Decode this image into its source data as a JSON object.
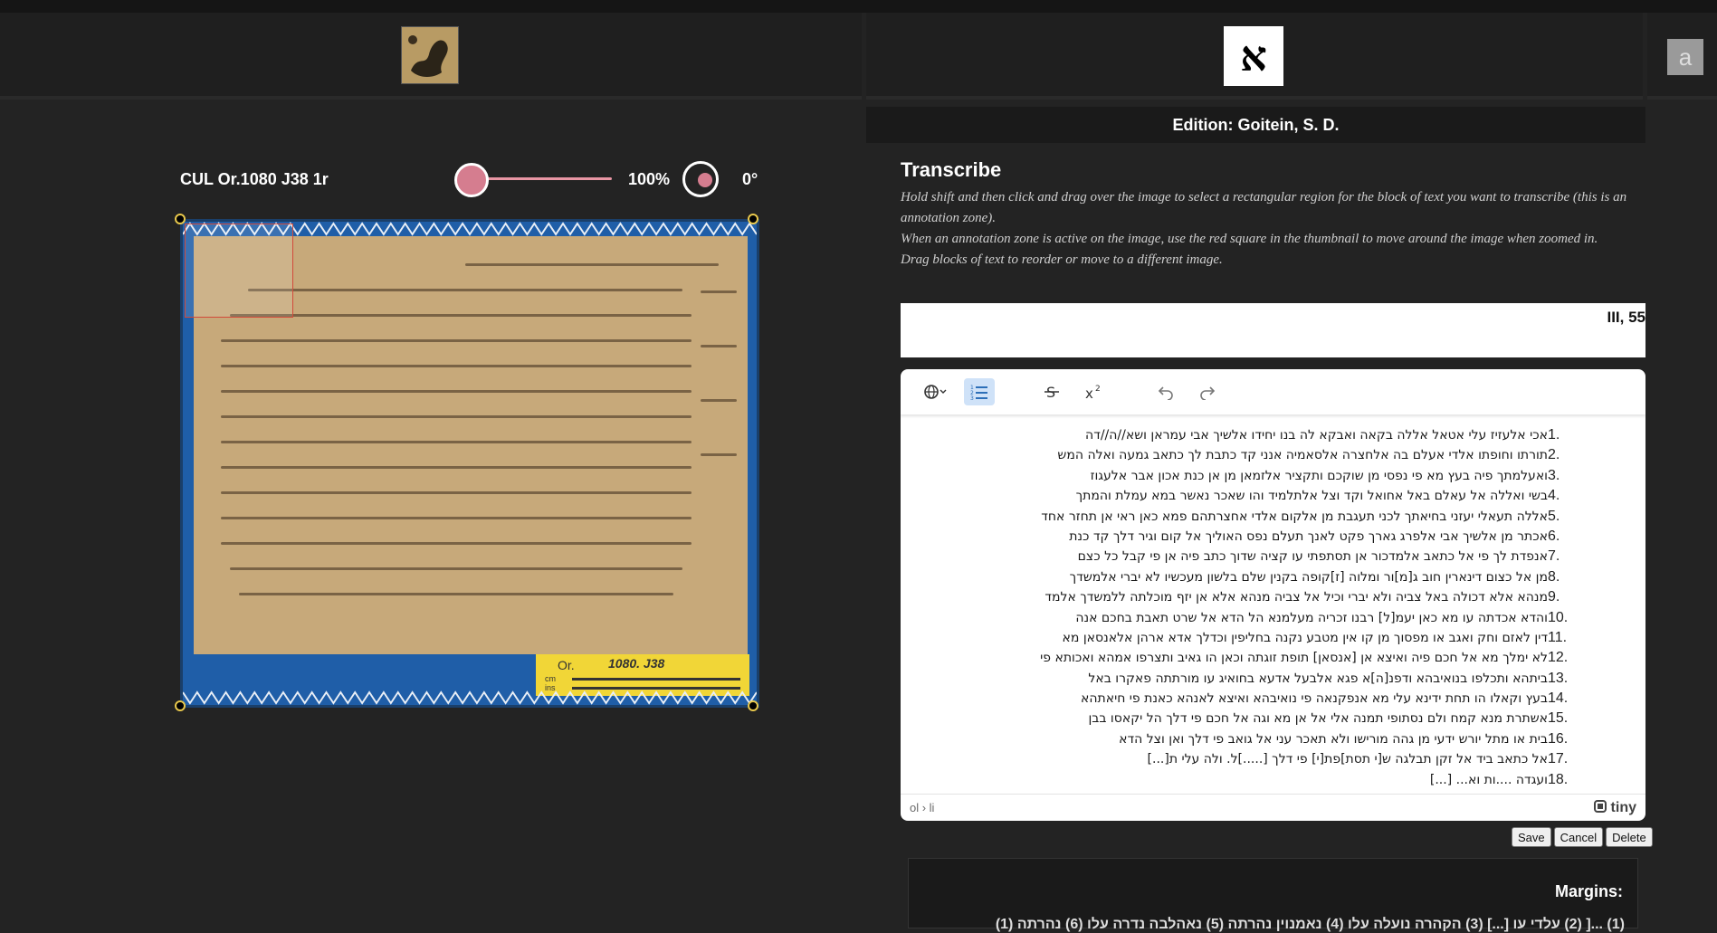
{
  "top_thumbs": {
    "alef_label": "א",
    "a_label": "a"
  },
  "edition": {
    "label": "Edition: Goitein, S. D."
  },
  "viewer": {
    "shelfmark": "CUL Or.1080 J38 1r",
    "zoom_percent": 100,
    "zoom_label": "100%",
    "rotation_label": "0°",
    "image_label": {
      "prefix": "Or.",
      "number": "1080. J38",
      "cm": "cm",
      "ins": "ins"
    }
  },
  "transcribe": {
    "title": "Transcribe",
    "help": [
      "Hold shift and then click and drag over the image to select a rectangular region for the block of text you want to transcribe (this is an annotation zone).",
      "When an annotation zone is active on the image, use the red square in the thumbnail to move around the image when zoomed in.",
      "Drag blocks of text to reorder or move to a different image."
    ],
    "locus": "III, 55"
  },
  "editor": {
    "toolbar": [
      "globe-language-icon",
      "numbered-list-icon",
      "strikethrough-icon",
      "superscript-icon",
      "undo-icon",
      "redo-icon"
    ],
    "lines": [
      {
        "n": "1.",
        "text": "אכי אלעזיז עלי אטאל אללה בקאה ואבקא לה בנו יחידו אלשיך אבי עמראן ושא//ה//דה"
      },
      {
        "n": "2.",
        "text": "תורתו וחופתו אלדי אעלם בה אלחצרה אלסאמיה אנני קד כתבת לך כתאב גמעה ואלה המש"
      },
      {
        "n": "3.",
        "text": "ואעלמתך פיה בעץ מא פי נפסי מן שוקכם ותקציר אלזמאן מן אן כנת אכון אבר אלעגוז"
      },
      {
        "n": "4.",
        "text": "בשי ואללה אל עאלם באל אחואל וקד וצל אלתלמיד והו שאכר נאשר במא עמלת והמתך"
      },
      {
        "n": "5.",
        "text": "אללה תעאלי יעזני בחיאתך לכני תעגבת מן אלקום אלדי אחצרתהם פמא כאן ראי אן תחזר אחד"
      },
      {
        "n": "6.",
        "text": "אכתר מן אלשיך אבי אלפרג גארך פקט לאנך תעלם נפס האוליך אל קום וגיר דלך קד כנת"
      },
      {
        "n": "7.",
        "text": "אנפדת לך פי אל כתאב אלמדכור אן תסתפתי עו קציה שדוך כתב פיה אן פי קבל כל כצם"
      },
      {
        "n": "8.",
        "text": "מן אל כצום דינארין חוב ג[מ]ור ומלוה [ז]קופה בקנין שלם בלשון מעכשיו לא יברי אלמשדך"
      },
      {
        "n": "9.",
        "text": "מנהא אלא דכולה באל צביה ולא יברי וכיל אל צביה מנהא אלא אן יזף מוכלתה ללמשדך אלמד"
      },
      {
        "n": "10.",
        "text": "והדא אכדתה עו מא כאן יעמ[ל] רבנו זכריה מעלמנא הל הדא אל שרט תאבת בחכם אנה"
      },
      {
        "n": "11.",
        "text": "דין לאזם וחק ואגב או מפסוך מן קו אין מטבע נקנה בחליפין וכדלך אדא ארהן אלאנסאן מא"
      },
      {
        "n": "12.",
        "text": "לא ימלך מא אל חכם פיה ואיצא אן [אנסאן] תופת זוגתה וכאן הו גאיב ותצרפו אמהא ואכותא פי"
      },
      {
        "n": "13.",
        "text": "ביתהא ותכלפו בנואיבהא ודפנ[ה]א פגא אלבעל אדעא בחואיג עו מורתתה פאקרו באל"
      },
      {
        "n": "14.",
        "text": "בעץ וקאלו הו תחת ידינא עלי מא אנפקנאה פי נואיבהא ואיצא לאנהא כאנת פי חיאתהא"
      },
      {
        "n": "15.",
        "text": "אשתרת מנא קמח ולם נסתופי תמנה אלי אל אן מא וגה אל חכם פי דלך הל יקאסו בבן"
      },
      {
        "n": "16.",
        "text": "בית או מתל יורש ידעי מן גהה מורישו ולא תאכר עני אל גואב פי דלך ואן וצל הדא"
      },
      {
        "n": "17.",
        "text": "אל כתאב ביד אל זקן תבלגה ש[י תסת]פת[י] פי דלך [.....]ל. ולה עלי ת[...]"
      },
      {
        "n": "18.",
        "text": "ועגדה ....ות וא... [...]"
      }
    ],
    "status_path": "ol › li",
    "brand": "tiny"
  },
  "actions": {
    "save": "Save",
    "cancel": "Cancel",
    "delete": "Delete"
  },
  "margins": {
    "title": "Margins:",
    "text": "(1) ...[ (2) עלדי עו [...] (3) הקהרה נועלה עלו (4) נאמנוין נהרתה (5) נאהלבה נדרה עלו (6) נהרתה (1)"
  },
  "colors": {
    "accent": "#d57d8f",
    "page_bg": "#232323",
    "image_border": "#1f5ea8"
  }
}
